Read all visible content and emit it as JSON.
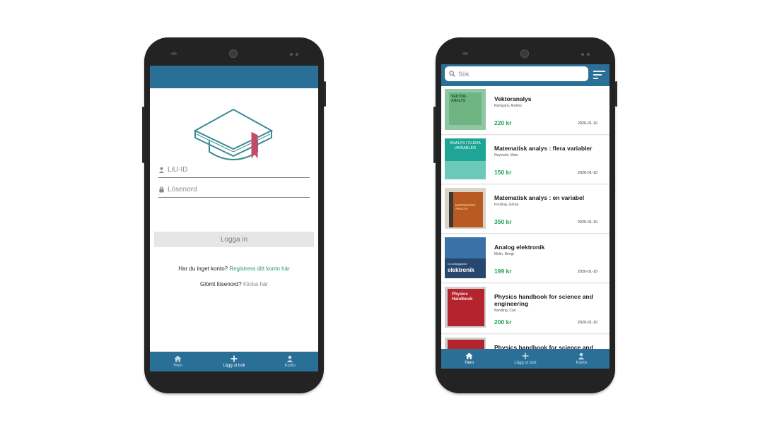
{
  "login": {
    "userid_placeholder": "LiU-ID",
    "password_placeholder": "Lösenord",
    "login_button": "Logga in",
    "no_account_text": "Har du inget konto? ",
    "register_link": "Registrera ditt konto här",
    "forgot_text": "Glömt lösenord? ",
    "forgot_link": "Klicka här"
  },
  "nav": {
    "home": "Hem",
    "add": "Lägg ut bok",
    "account": "Konto"
  },
  "list": {
    "search_placeholder": "Sök",
    "books": [
      {
        "title": "Vektoranalys",
        "author": "Ramgard, Anders",
        "price": "220 kr",
        "date": "2020-01-10"
      },
      {
        "title": "Matematisk analys : flera variabler",
        "author": "Neymark, Mats",
        "price": "150 kr",
        "date": "2020-01-10"
      },
      {
        "title": "Matematisk analys : en variabel",
        "author": "Forsling, Göran",
        "price": "350 kr",
        "date": "2020-01-10"
      },
      {
        "title": "Analog elektronik",
        "author": "Molin, Bengt",
        "price": "199 kr",
        "date": "2020-01-10"
      },
      {
        "title": "Physics handbook for science and engineering",
        "author": "Nordling, Carl",
        "price": "200 kr",
        "date": "2020-01-10"
      },
      {
        "title": "Physics handbook for science and",
        "author": "",
        "price": "",
        "date": ""
      }
    ],
    "covers": {
      "vektor": "VEKTOR-ANALYS",
      "flera": "ANALYS I FLERA VARIABLER",
      "envar": "MATEMATISK ANALYS",
      "elek_small": "Grundläggande",
      "elek_big": "elektronik",
      "phys": "Physics Handbook"
    }
  },
  "colors": {
    "primary": "#2a6f96",
    "price_green": "#22a45a",
    "link_green": "#2d9a6b"
  }
}
